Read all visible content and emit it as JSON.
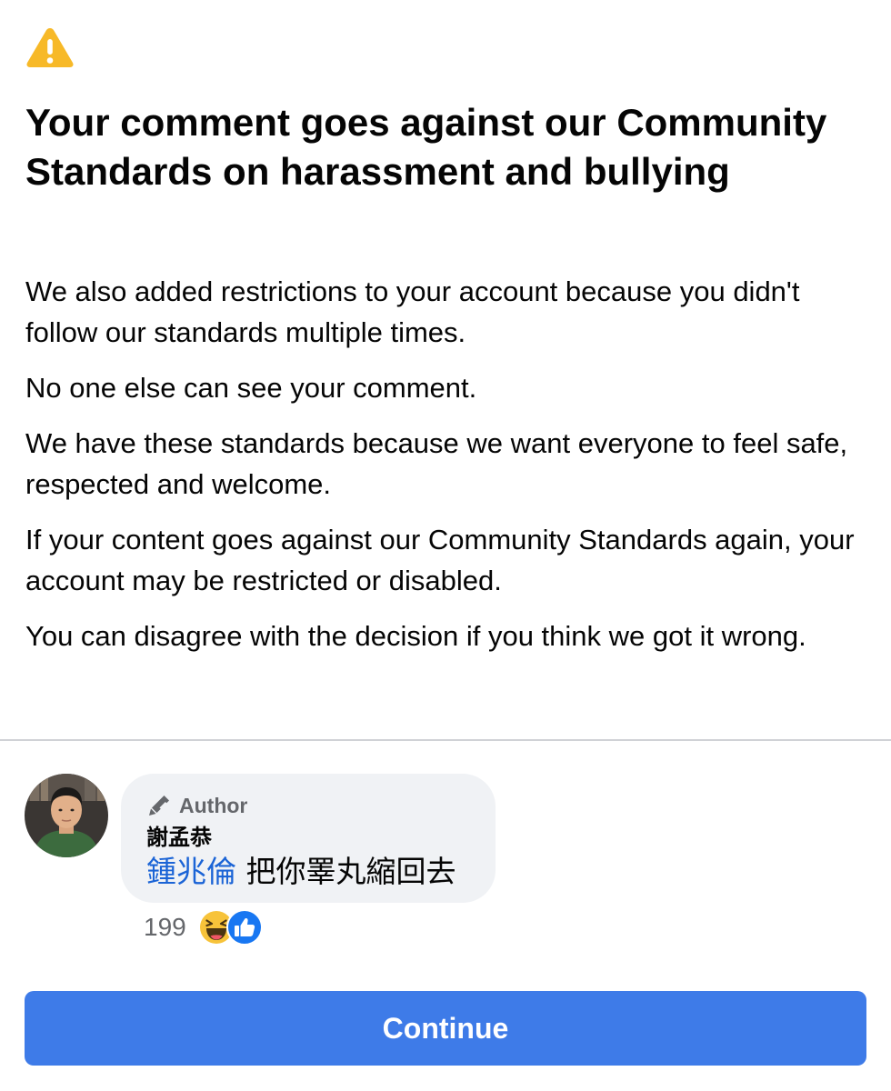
{
  "alert": {
    "icon": "warning-icon",
    "title": "Your comment goes against our Community Standards on harassment and bullying",
    "paragraphs": [
      "We also added restrictions to your account because you didn't follow our standards multiple times.",
      "No one else can see your comment.",
      "We have these standards because we want everyone to feel safe, respected and welcome.",
      "If your content goes against our Community Standards again, your account may be restricted or disabled.",
      "You can disagree with the decision if you think we got it wrong."
    ]
  },
  "comment": {
    "badge_icon": "pencil-icon",
    "badge_label": "Author",
    "author_name": "謝孟恭",
    "mention": "鍾兆倫",
    "text": "把你睪丸縮回去",
    "reaction_count": "199",
    "reactions": [
      "haha-icon",
      "like-icon"
    ]
  },
  "button": {
    "label": "Continue"
  },
  "colors": {
    "accent": "#3e7be8",
    "warning": "#f7b928",
    "mention": "#1b64d6",
    "bubble": "#f0f2f5",
    "secondary_text": "#65676b"
  }
}
